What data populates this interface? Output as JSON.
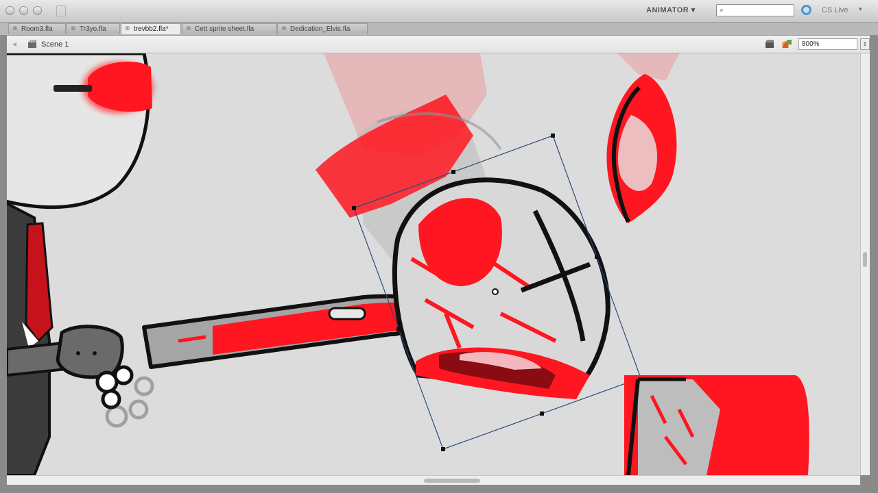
{
  "workspace": {
    "label": "ANIMATOR ▾"
  },
  "search": {
    "placeholder": ""
  },
  "cslive": {
    "label": "CS Live",
    "arrow": "▾"
  },
  "tabs": [
    {
      "label": "Room3.fla",
      "active": false
    },
    {
      "label": "Tr3yo.fla",
      "active": false
    },
    {
      "label": "trevbb2.fla*",
      "active": true
    },
    {
      "label": "Cett sprite sheet.fla",
      "active": false
    },
    {
      "label": "Dedication_Elvis.fla",
      "active": false
    }
  ],
  "editbar": {
    "scene_label": "Scene 1",
    "zoom": "800%"
  },
  "icons": {
    "back": "back-arrow-icon",
    "scene": "scene-clapper-icon",
    "edit_scene": "edit-scene-icon",
    "edit_symbol": "edit-symbol-icon",
    "search": "magnifier-icon",
    "cslive": "cs-live-icon"
  },
  "colors": {
    "blood": "#ff0f1a",
    "stage": "#dcdcdc",
    "outline": "#111111",
    "selection": "#2a4a7a"
  }
}
